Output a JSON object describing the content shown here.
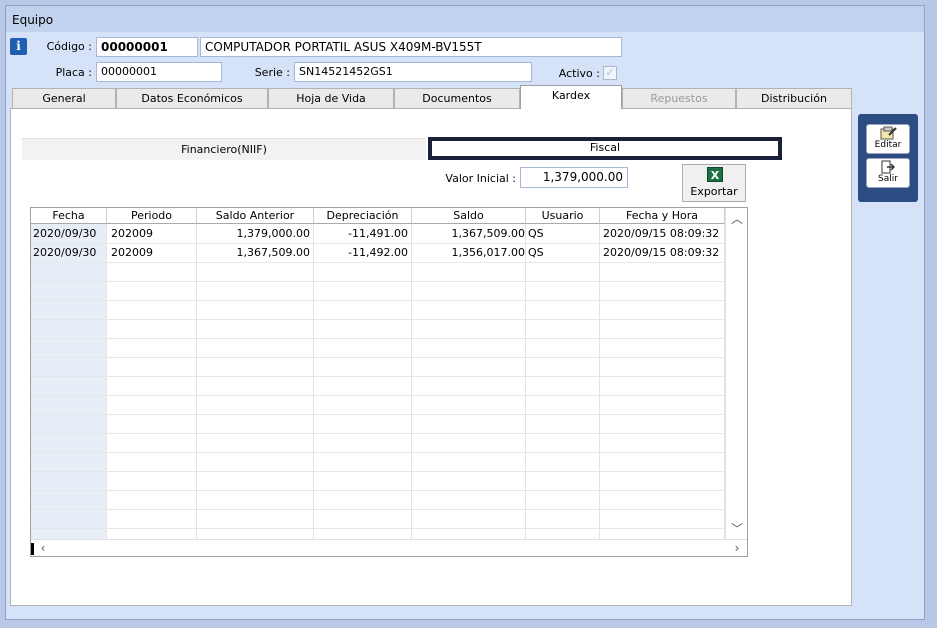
{
  "window": {
    "title": "Equipo"
  },
  "equipo": {
    "codigo_label": "Código :",
    "codigo_value": "00000001",
    "descripcion": "COMPUTADOR PORTATIL ASUS X409M-BV155T",
    "placa_label": "Placa :",
    "placa_value": "00000001",
    "serie_label": "Serie :",
    "serie_value": "SN14521452GS1",
    "activo_label": "Activo :",
    "activo_checked": true
  },
  "tabs": [
    {
      "label": "General"
    },
    {
      "label": "Datos Económicos"
    },
    {
      "label": "Hoja de Vida"
    },
    {
      "label": "Documentos"
    },
    {
      "label": "Kardex",
      "active": true
    },
    {
      "label": "Repuestos",
      "disabled": true
    },
    {
      "label": "Distribución"
    }
  ],
  "kardex": {
    "subtab_financiero": "Financiero(NIIF)",
    "subtab_fiscal": "Fiscal",
    "valor_inicial_label": "Valor Inicial :",
    "valor_inicial_value": "1,379,000.00",
    "exportar_label": "Exportar",
    "columns": [
      "Fecha",
      "Periodo",
      "Saldo Anterior",
      "Depreciación",
      "Saldo",
      "Usuario",
      "Fecha y Hora"
    ],
    "rows": [
      [
        "2020/09/30",
        "202009",
        "1,379,000.00",
        "-11,491.00",
        "1,367,509.00",
        "QS",
        "2020/09/15 08:09:32"
      ],
      [
        "2020/09/30",
        "202009",
        "1,367,509.00",
        "-11,492.00",
        "1,356,017.00",
        "QS",
        "2020/09/15 08:09:32"
      ]
    ]
  },
  "sidebar": {
    "editar_label": "Editar",
    "salir_label": "Salir"
  },
  "icons": {
    "info": "info-icon",
    "excel": "excel-icon",
    "edit": "edit-icon",
    "exit": "exit-icon"
  }
}
